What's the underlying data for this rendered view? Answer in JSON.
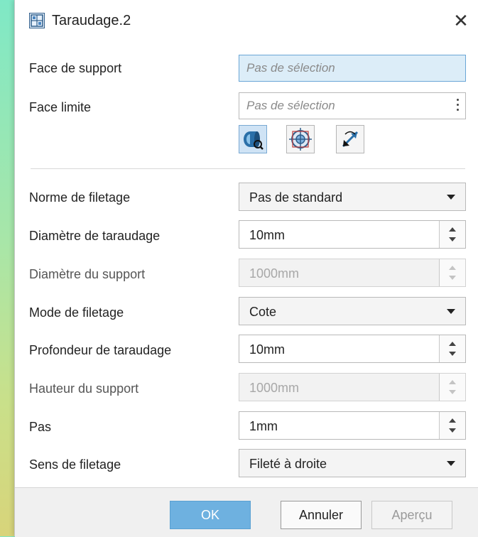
{
  "window": {
    "title": "Taraudage.2",
    "close_label": "✕"
  },
  "selection": {
    "face_support": {
      "label": "Face de support",
      "value": "Pas de sélection"
    },
    "face_limit": {
      "label": "Face limite",
      "value": "Pas de sélection"
    }
  },
  "toolbar": {
    "icons": [
      "cylinder-select-icon",
      "target-select-icon",
      "reverse-direction-icon"
    ]
  },
  "fields": {
    "norme": {
      "label": "Norme de filetage",
      "value": "Pas de standard"
    },
    "diametre_taraudage": {
      "label": "Diamètre de taraudage",
      "value": "10mm"
    },
    "diametre_support": {
      "label": "Diamètre du support",
      "value": "1000mm"
    },
    "mode": {
      "label": "Mode de filetage",
      "value": "Cote"
    },
    "profondeur": {
      "label": "Profondeur de taraudage",
      "value": "10mm"
    },
    "hauteur_support": {
      "label": "Hauteur du support",
      "value": "1000mm"
    },
    "pas": {
      "label": "Pas",
      "value": "1mm"
    },
    "sens": {
      "label": "Sens de filetage",
      "value": "Fileté à droite"
    }
  },
  "footer": {
    "ok_label": "OK",
    "cancel_label": "Annuler",
    "preview_label": "Aperçu"
  },
  "colors": {
    "accent": "#6eb1e0",
    "active_field": "#dcedf8"
  }
}
